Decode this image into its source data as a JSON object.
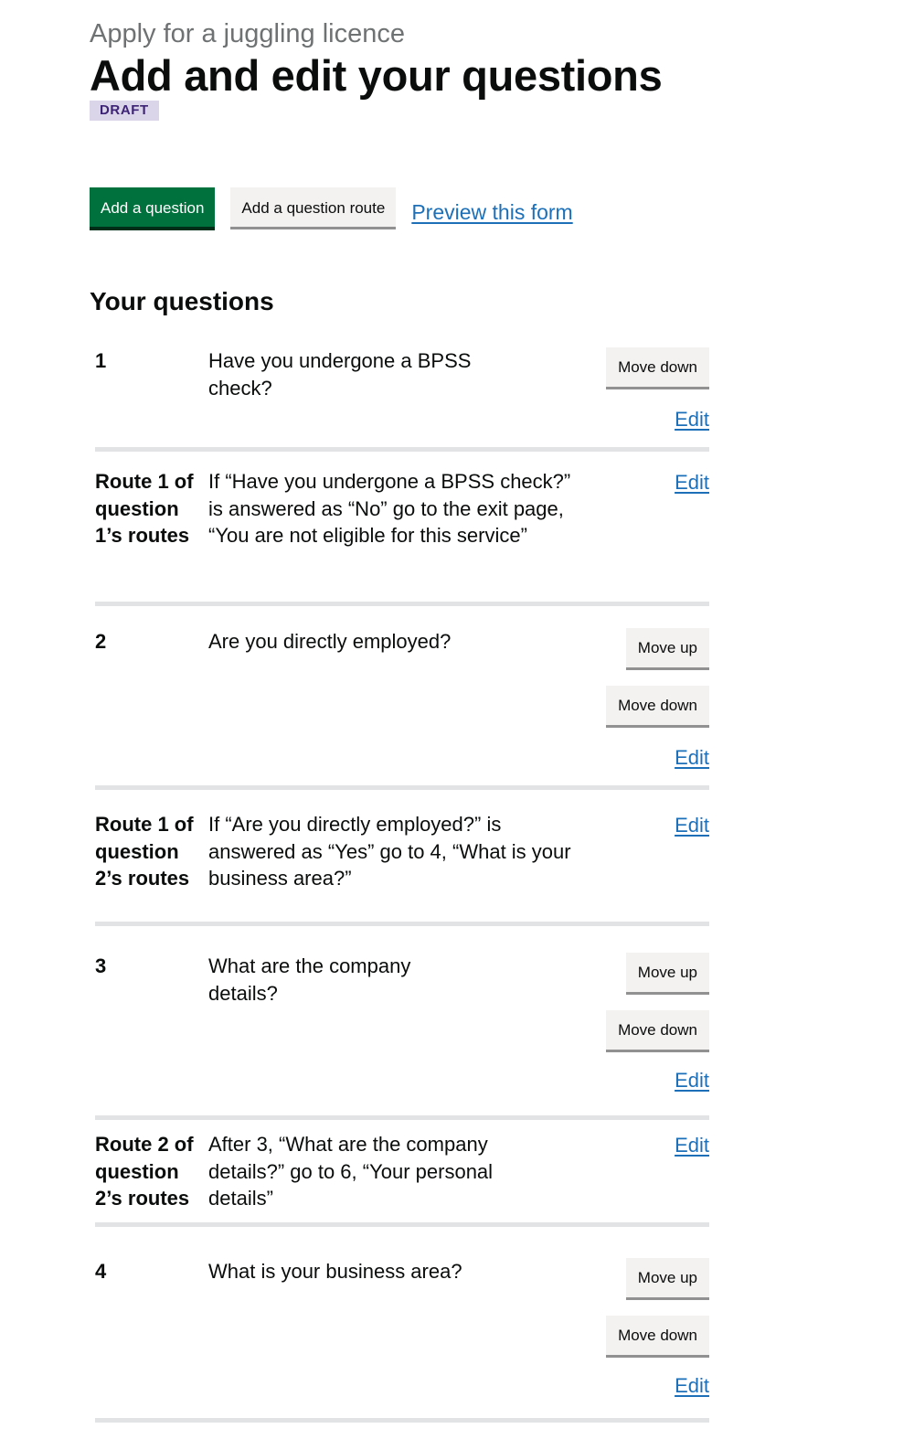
{
  "header": {
    "caption": "Apply for a juggling licence",
    "title": "Add and edit your questions",
    "status_tag": "DRAFT"
  },
  "actions": {
    "add_question": "Add a question",
    "add_route": "Add a question route",
    "preview": "Preview this form"
  },
  "questions_section": {
    "heading": "Your questions",
    "move_up": "Move up",
    "move_down": "Move down",
    "edit": "Edit",
    "rows": [
      {
        "key": "1",
        "text": "Have you undergone a BPSS check?"
      },
      {
        "key": "Route 1 of question 1’s routes",
        "text": "If “Have you undergone a BPSS check?” is answered as “No” go to the exit page, “You are not eligible for this service”"
      },
      {
        "key": "2",
        "text": "Are you directly employed?"
      },
      {
        "key": "Route 1 of question 2’s routes",
        "text": "If “Are you directly employed?” is answered as “Yes” go to 4, “What is your business area?”"
      },
      {
        "key": "3",
        "text": "What are the company details?"
      },
      {
        "key": "Route 2 of question 2’s routes",
        "text": "After 3, “What are the company details?” go to 6, “Your personal details”"
      },
      {
        "key": "4",
        "text": "What is your business area?"
      }
    ]
  }
}
